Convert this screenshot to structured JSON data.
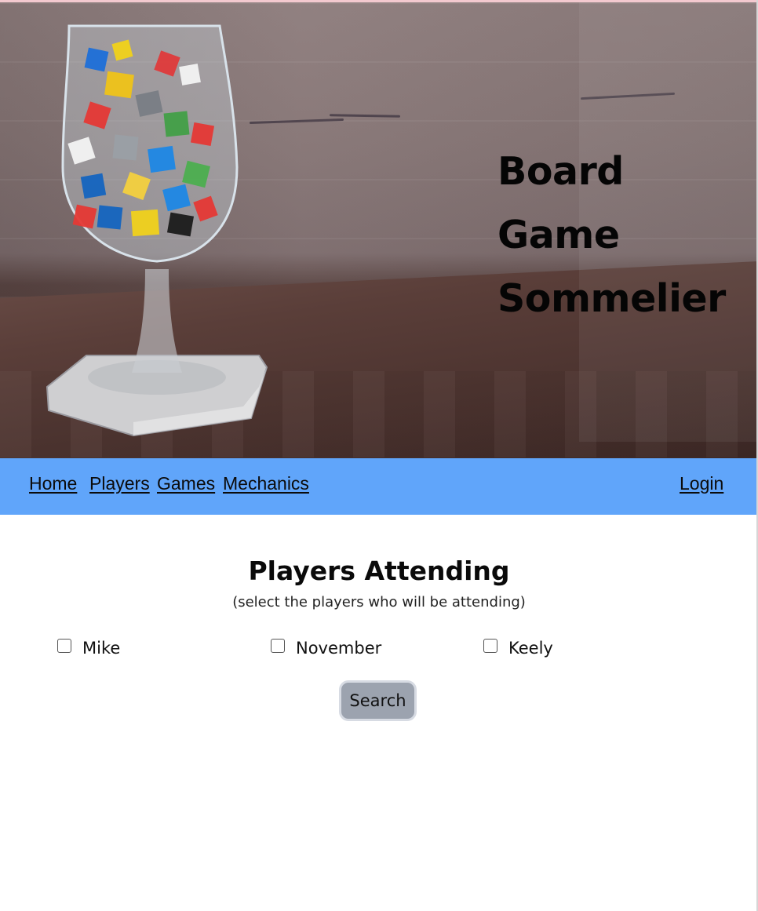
{
  "header": {
    "title_lines": [
      "Board",
      "Game",
      "Sommelier"
    ],
    "hero_image": "glass-of-game-meeples-and-dice"
  },
  "nav": {
    "links": [
      "Home",
      "Players",
      "Games",
      "Mechanics"
    ],
    "login": "Login",
    "color": "#60a5fa"
  },
  "main": {
    "title": "Players Attending",
    "subtitle": "(select the players who will be attending)",
    "players": [
      {
        "name": "Mike",
        "checked": false
      },
      {
        "name": "November",
        "checked": false
      },
      {
        "name": "Keely",
        "checked": false
      }
    ],
    "search_label": "Search"
  }
}
